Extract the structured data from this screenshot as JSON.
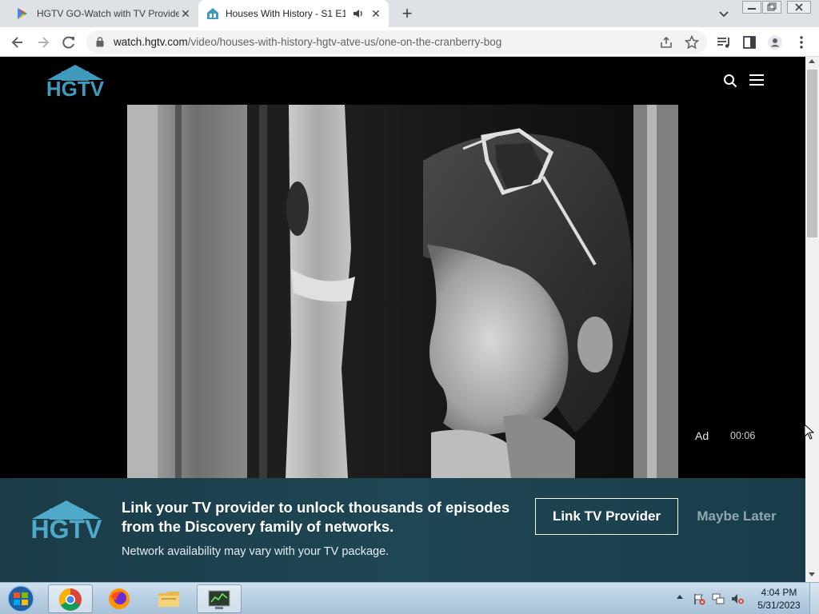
{
  "browser": {
    "tabs": [
      {
        "title": "HGTV GO-Watch with TV Provide",
        "active": false
      },
      {
        "title": "Houses With History - S1 E1",
        "active": true
      }
    ],
    "url": {
      "host": "watch.hgtv.com",
      "path": "/video/houses-with-history-hgtv-atve-us/one-on-the-cranberry-bog"
    }
  },
  "page": {
    "logo_text": "HGTV",
    "player": {
      "ad_label": "Ad",
      "ad_time": "00:06"
    },
    "banner": {
      "logo_text": "HGTV",
      "heading": "Link your TV provider to unlock thousands of episodes from the Discovery family of networks.",
      "subtext": "Network availability may vary with your TV package.",
      "primary_button": "Link TV Provider",
      "secondary_button": "Maybe Later"
    }
  },
  "taskbar": {
    "clock_time": "4:04 PM",
    "clock_date": "5/31/2023"
  },
  "colors": {
    "brand_teal": "#3e9bbd",
    "banner_bg": "#1f4654",
    "page_bg": "#000000"
  }
}
